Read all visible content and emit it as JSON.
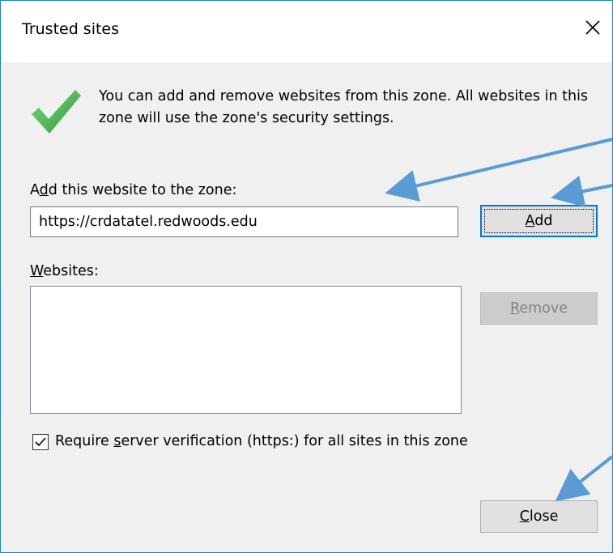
{
  "dialog": {
    "title": "Trusted sites",
    "close_glyph": "✕"
  },
  "info": {
    "text": "You can add and remove websites from this zone. All websites in this zone will use the zone's security settings."
  },
  "add_site": {
    "label_pre": "A",
    "label_mnemonic": "d",
    "label_post": "d this website to the zone:",
    "value": "https://crdatatel.redwoods.edu"
  },
  "buttons": {
    "add_mnemonic": "A",
    "add_rest": "dd",
    "remove_mnemonic": "R",
    "remove_rest": "emove",
    "close_mnemonic": "C",
    "close_rest": "lose"
  },
  "websites": {
    "label_mnemonic": "W",
    "label_rest": "ebsites:",
    "items": []
  },
  "require_verification": {
    "checked": true,
    "label_pre": "Require ",
    "label_mnemonic": "s",
    "label_post": "erver verification (https:) for all sites in this zone"
  },
  "colors": {
    "accent": "#0078d7",
    "annotation_arrow": "#5b9bd5",
    "check_green": "#3dab3d"
  }
}
